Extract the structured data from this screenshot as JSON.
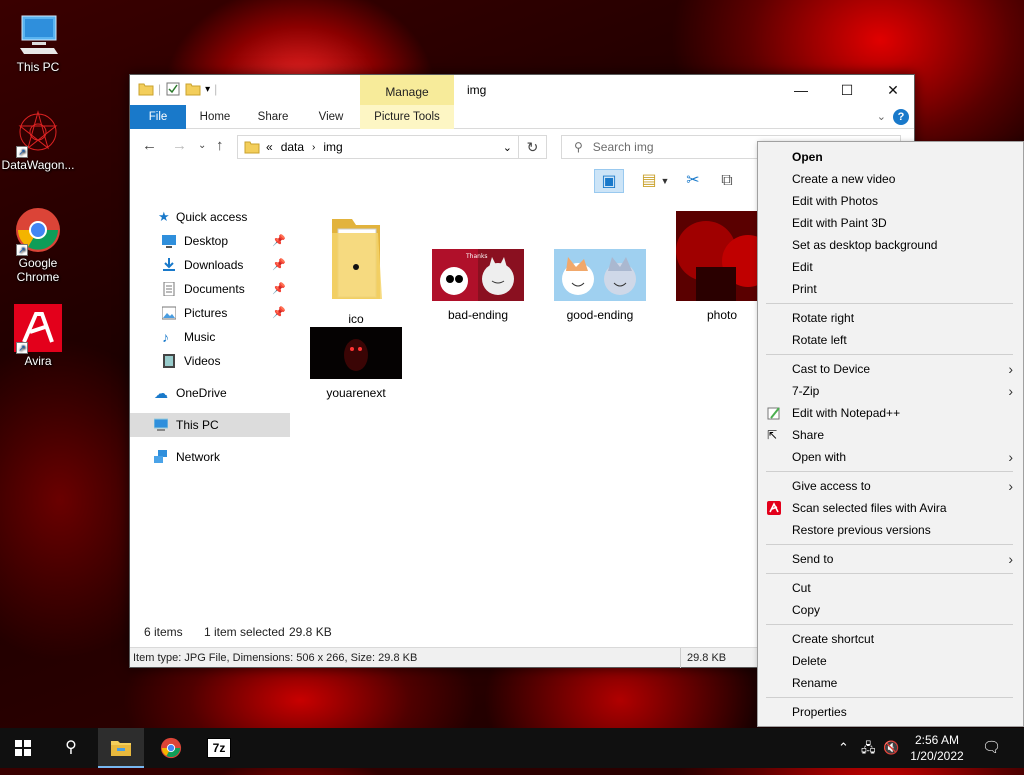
{
  "desktop": {
    "icons": [
      {
        "label": "This PC"
      },
      {
        "label": "DataWagon..."
      },
      {
        "label": "Google Chrome"
      },
      {
        "label": "Avira"
      }
    ]
  },
  "window": {
    "title": "img",
    "manage_tab": "Manage",
    "picture_tools_tab": "Picture Tools",
    "ribbon_tabs": [
      "File",
      "Home",
      "Share",
      "View"
    ],
    "address": {
      "prefix": "«",
      "path": [
        "data",
        "img"
      ]
    },
    "search_placeholder": "Search img",
    "nav": {
      "quick_access": "Quick access",
      "items": [
        {
          "label": "Desktop"
        },
        {
          "label": "Downloads"
        },
        {
          "label": "Documents"
        },
        {
          "label": "Pictures"
        },
        {
          "label": "Music"
        },
        {
          "label": "Videos"
        }
      ],
      "onedrive": "OneDrive",
      "this_pc": "This PC",
      "network": "Network"
    },
    "files": [
      {
        "name": "ico",
        "type": "folder"
      },
      {
        "name": "bad-ending",
        "type": "image"
      },
      {
        "name": "good-ending",
        "type": "image"
      },
      {
        "name": "photo",
        "type": "image"
      },
      {
        "name": "youarenext",
        "type": "image"
      }
    ],
    "status": {
      "items": "6 items",
      "selected": "1 item selected",
      "selected_size": "29.8 KB"
    },
    "details_bar": {
      "text": "Item type: JPG File, Dimensions: 506 x 266, Size: 29.8 KB",
      "size": "29.8 KB"
    }
  },
  "context_menu": {
    "groups": [
      [
        "Open",
        "Create a new video",
        "Edit with Photos",
        "Edit with Paint 3D",
        "Set as desktop background",
        "Edit",
        "Print"
      ],
      [
        "Rotate right",
        "Rotate left"
      ],
      [
        "Cast to Device",
        "7-Zip",
        "Edit with Notepad++",
        "Share",
        "Open with"
      ],
      [
        "Give access to",
        "Scan selected files with Avira",
        "Restore previous versions"
      ],
      [
        "Send to"
      ],
      [
        "Cut",
        "Copy"
      ],
      [
        "Create shortcut",
        "Delete",
        "Rename"
      ],
      [
        "Properties"
      ]
    ]
  },
  "taskbar": {
    "time": "2:56 AM",
    "date": "1/20/2022",
    "zip_label": "7z"
  },
  "colors": {
    "accent": "#1979ca",
    "manage": "#f7eb9a"
  }
}
